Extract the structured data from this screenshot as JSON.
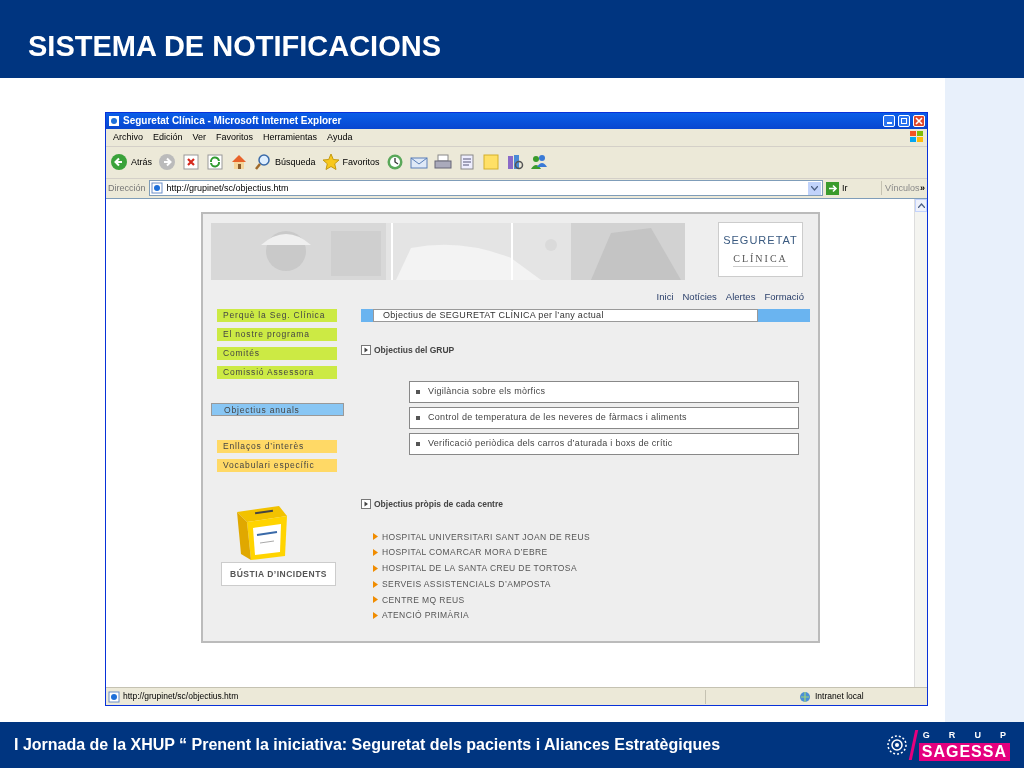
{
  "slide": {
    "title": "SISTEMA DE NOTIFICACIONS",
    "footer": "I Jornada de la XHUP “ Prenent la iniciativa: Seguretat dels pacients i Aliances Estratègiques",
    "logo_letters": [
      "G",
      "R",
      "U",
      "P"
    ],
    "logo_name": "SAGESSA"
  },
  "browser": {
    "title": "Seguretat Clínica - Microsoft Internet Explorer",
    "menu": [
      "Archivo",
      "Edición",
      "Ver",
      "Favoritos",
      "Herramientas",
      "Ayuda"
    ],
    "toolbar": [
      {
        "kind": "back",
        "label": "Atrás"
      },
      {
        "kind": "forward"
      },
      {
        "kind": "stop"
      },
      {
        "kind": "refresh"
      },
      {
        "kind": "home"
      },
      {
        "kind": "search",
        "label": "Búsqueda"
      },
      {
        "kind": "favorites",
        "label": "Favoritos"
      },
      {
        "kind": "history"
      },
      {
        "kind": "mail"
      },
      {
        "kind": "print"
      },
      {
        "kind": "edit"
      },
      {
        "kind": "note"
      },
      {
        "kind": "research"
      },
      {
        "kind": "messenger"
      }
    ],
    "address": {
      "label": "Dirección",
      "value": "http://grupinet/sc/objectius.htm",
      "go": "Ir",
      "links": "Vínculos",
      "chevron": "»"
    },
    "status": {
      "url": "http://grupinet/sc/objectius.htm",
      "zone": "Intranet local"
    }
  },
  "page": {
    "logo": [
      "SEGURETAT",
      "CLÍNICA"
    ],
    "nav": [
      "Inici",
      "Notícies",
      "Alertes",
      "Formació"
    ],
    "sidebar": [
      [
        {
          "label": "Perquè la Seg. Clínica",
          "selected": false,
          "color": "#ccea44"
        },
        {
          "label": "El nostre programa",
          "selected": false,
          "color": "#ccea44"
        },
        {
          "label": "Comités",
          "selected": false,
          "color": "#ccea44"
        },
        {
          "label": "Comissió Assessora",
          "selected": false,
          "color": "#ccea44"
        }
      ],
      [
        {
          "label": "Objectius anuals",
          "selected": true,
          "color": "#88c6f4"
        }
      ],
      [
        {
          "label": "Enllaços d’interès",
          "selected": false,
          "color": "#ffd966"
        },
        {
          "label": "Vocabulari específic",
          "selected": false,
          "color": "#ffd966"
        }
      ]
    ],
    "heading": "Objectius de SEGURETAT CLÍNICA per l’any actual",
    "group_title": "Objectius del GRUP",
    "group_items": [
      "Vigilància sobre els mòrfics",
      "Control de temperatura de les neveres de fàrmacs i aliments",
      "Verificació periòdica dels carros d’aturada i boxs de crític"
    ],
    "centres_title": "Objectius pròpis de cada centre",
    "centres": [
      "HOSPITAL UNIVERSITARI SANT JOAN DE REUS",
      "HOSPITAL COMARCAR MORA D’EBRE",
      "HOSPITAL DE LA SANTA CREU DE TORTOSA",
      "SERVEIS ASSISTENCIALS D’AMPOSTA",
      "CENTRE MQ REUS",
      "ATENCIÓ PRIMÀRIA"
    ],
    "mailbox": "BÚSTIA D’INCIDENTS"
  }
}
